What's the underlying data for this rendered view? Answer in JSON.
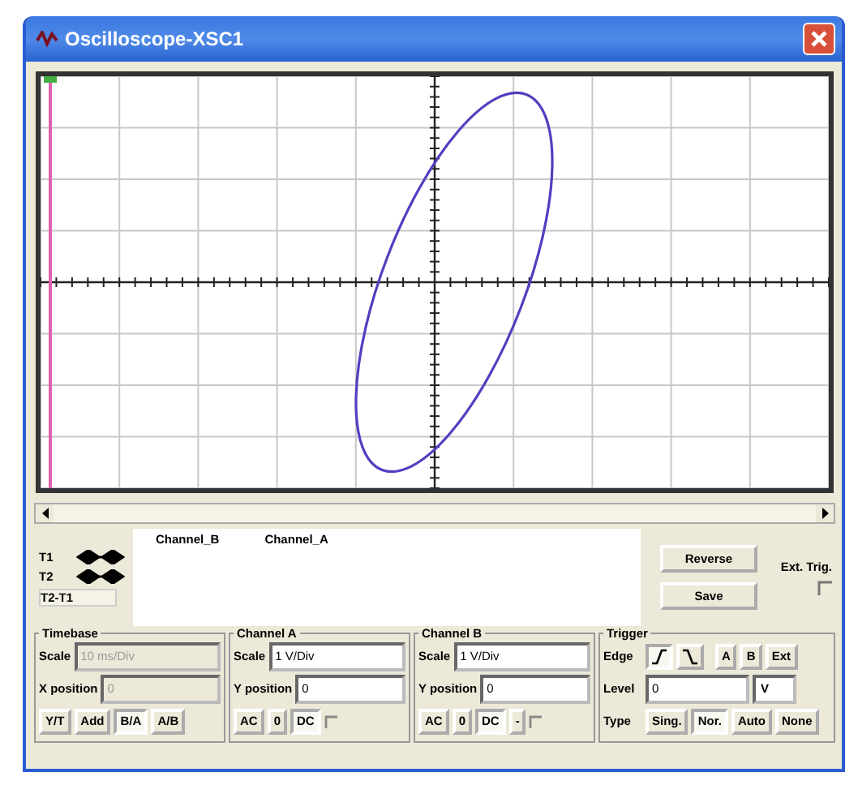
{
  "window": {
    "title": "Oscilloscope-XSC1"
  },
  "cursors": [
    {
      "label": "T1",
      "kind": "cursor"
    },
    {
      "label": "T2",
      "kind": "cursor"
    },
    {
      "label": "T2-T1",
      "kind": "difference"
    }
  ],
  "readout_columns": [
    "Channel_B",
    "Channel_A"
  ],
  "buttons": [
    "Reverse",
    "Save"
  ],
  "ext_trigger": {
    "label": "Ext. Trig."
  },
  "timebase": {
    "title": "Timebase",
    "scale": {
      "label": "Scale",
      "value": "10 ms/Div",
      "disabled": true
    },
    "position": {
      "label": "X position",
      "value": "0",
      "disabled": true
    },
    "modes": [
      {
        "label": "Y/T",
        "selected": false
      },
      {
        "label": "Add",
        "selected": false
      },
      {
        "label": "B/A",
        "selected": true
      },
      {
        "label": "A/B",
        "selected": false
      }
    ]
  },
  "channels": [
    {
      "title": "Channel A",
      "scale": {
        "label": "Scale",
        "value": "1 V/Div",
        "disabled": false
      },
      "position": {
        "label": "Y position",
        "value": "0",
        "disabled": false
      },
      "coupling": [
        {
          "label": "AC",
          "selected": false
        },
        {
          "label": "0",
          "selected": false
        },
        {
          "label": "DC",
          "selected": true
        }
      ]
    },
    {
      "title": "Channel B",
      "scale": {
        "label": "Scale",
        "value": "1 V/Div",
        "disabled": false
      },
      "position": {
        "label": "Y position",
        "value": "0",
        "disabled": false
      },
      "coupling": [
        {
          "label": "AC",
          "selected": false
        },
        {
          "label": "0",
          "selected": false
        },
        {
          "label": "DC",
          "selected": true
        }
      ],
      "invert": "-"
    }
  ],
  "trigger": {
    "title": "Trigger",
    "edge_label": "Edge",
    "edges": [
      {
        "kind": "rising",
        "selected": true
      },
      {
        "kind": "falling",
        "selected": false
      }
    ],
    "sources": [
      "A",
      "B",
      "Ext"
    ],
    "level": {
      "label": "Level",
      "value": "0",
      "unit": "V"
    },
    "type_label": "Type",
    "types": [
      {
        "label": "Sing.",
        "selected": false
      },
      {
        "label": "Nor.",
        "selected": true
      },
      {
        "label": "Auto",
        "selected": false
      },
      {
        "label": "None",
        "selected": false
      }
    ]
  }
}
